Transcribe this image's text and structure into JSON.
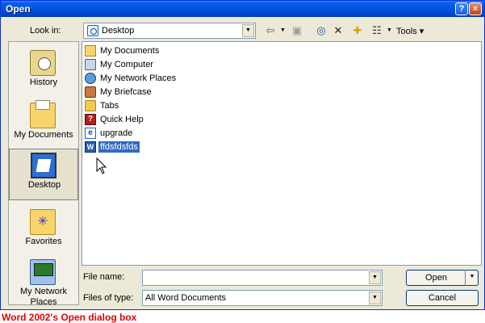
{
  "window": {
    "title": "Open",
    "help_glyph": "?",
    "close_glyph": "×"
  },
  "lookin": {
    "label": "Look in:",
    "value": "Desktop"
  },
  "toolbar": {
    "back_glyph": "⇦",
    "up_glyph": "▣",
    "search_glyph": "◎",
    "delete_glyph": "✕",
    "newfolder_glyph": "✚",
    "views_glyph": "☷",
    "dropdown_glyph": "▼",
    "tools_label": "Tools",
    "tools_arrow": "▾"
  },
  "places": [
    {
      "label": "History",
      "icon": "history-icon"
    },
    {
      "label": "My Documents",
      "icon": "my-documents-icon"
    },
    {
      "label": "Desktop",
      "icon": "desktop-icon",
      "selected": true
    },
    {
      "label": "Favorites",
      "icon": "favorites-icon"
    },
    {
      "label": "My Network Places",
      "icon": "network-places-icon"
    }
  ],
  "favorites_glyph": "✳",
  "files": [
    {
      "name": "My Documents",
      "icon": "my-documents-icon"
    },
    {
      "name": "My Computer",
      "icon": "my-computer-icon"
    },
    {
      "name": "My Network Places",
      "icon": "network-places-icon"
    },
    {
      "name": "My Briefcase",
      "icon": "briefcase-icon"
    },
    {
      "name": "Tabs",
      "icon": "folder-icon"
    },
    {
      "name": "Quick Help",
      "icon": "help-file-icon",
      "glyph": "?"
    },
    {
      "name": "upgrade",
      "icon": "shortcut-icon",
      "glyph": "e"
    },
    {
      "name": "ffdsfdsfds",
      "icon": "word-document-icon",
      "glyph": "W",
      "selected": true
    }
  ],
  "filename": {
    "label": "File name:",
    "value": ""
  },
  "filetype": {
    "label": "Files of type:",
    "value": "All Word Documents"
  },
  "buttons": {
    "open": "Open",
    "cancel": "Cancel",
    "open_split_glyph": "▼"
  },
  "caption": "Word 2002's Open dialog box",
  "colors": {
    "title_bar": "#0054e3",
    "selection": "#316ac5",
    "caption": "#e00000"
  }
}
